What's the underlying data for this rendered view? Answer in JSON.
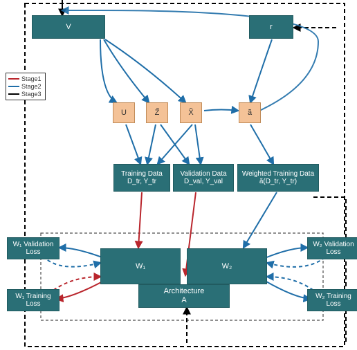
{
  "legend": {
    "stage1": "Stage1",
    "stage2": "Stage2",
    "stage3": "Stage3"
  },
  "top": {
    "V": "V",
    "r": "r"
  },
  "vars": {
    "U": "U",
    "Zt": "Z̃",
    "Xt": "X̃",
    "at": "ã"
  },
  "data": {
    "train": "Training Data\nD_tr, Y_tr",
    "val": "Validation Data\nD_val, Y_val",
    "wtrain": "Weighted Training Data\nã(D_tr, Y_tr)"
  },
  "loss": {
    "w1val": "W₁ Validation Loss",
    "w2val": "W₂ Validation Loss",
    "w1train": "W₁ Training Loss",
    "w2train": "W₂ Training Loss"
  },
  "arch": {
    "W1": "W₁",
    "W2": "W₂",
    "A": "Architecture\nA"
  },
  "colors": {
    "stage1": "#b9252c",
    "stage2": "#1f6ea8",
    "stage3": "#000000",
    "teal": "#2a6f76",
    "orange": "#f4c297"
  }
}
